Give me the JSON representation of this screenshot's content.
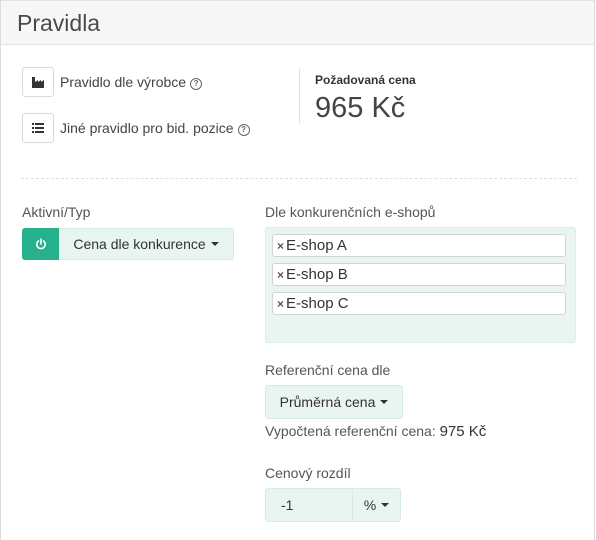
{
  "panel": {
    "title": "Pravidla"
  },
  "rules": {
    "manufacturer": {
      "label": "Pravidlo dle výrobce",
      "help": "?"
    },
    "other": {
      "label": "Jiné pravidlo pro bid. pozice",
      "help": "?"
    }
  },
  "required_price": {
    "label": "Požadovaná cena",
    "value": "965 Kč"
  },
  "active_type": {
    "label": "Aktivní/Typ",
    "selected": "Cena dle konkurence"
  },
  "competitors": {
    "label": "Dle konkurenčních e-shopů",
    "remove_symbol": "×",
    "tags": [
      "E-shop A",
      "E-shop B",
      "E-shop C"
    ]
  },
  "reference": {
    "label": "Referenční cena dle",
    "selected": "Průměrná cena",
    "computed_label": "Vypočtená referenční cena:",
    "computed_value": "975 Kč"
  },
  "price_diff": {
    "label": "Cenový rozdíl",
    "value": "-1",
    "unit": "%"
  },
  "colors": {
    "accent": "#26b18c",
    "field_bg": "#e9f5f1"
  }
}
